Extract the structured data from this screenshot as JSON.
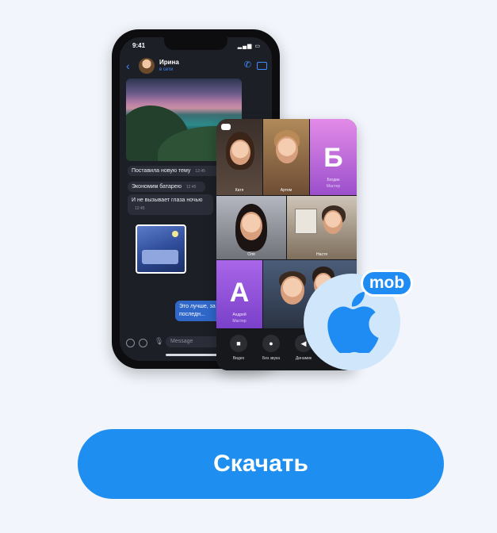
{
  "colors": {
    "background": "#f2f6fc",
    "accent": "#1f8ef1",
    "badge_light": "#cfe6fb"
  },
  "phone": {
    "status_time": "9:41",
    "contact": {
      "name": "Ирина",
      "status": "в сети"
    },
    "messages": [
      {
        "text": "Поставила новую тему",
        "time": "12:45"
      },
      {
        "text": "Экономим батарею",
        "time": "12:45"
      },
      {
        "text": "И не вызывает глаза ночью",
        "time": "12:45"
      }
    ],
    "outgoing_message": "Это лучше, за последн...",
    "composer": {
      "placeholder": "Message"
    },
    "icons": [
      "back-icon",
      "call-icon",
      "video-icon",
      "attach-icon",
      "emoji-icon",
      "mic-icon"
    ]
  },
  "call": {
    "participants": [
      {
        "name": "Катя"
      },
      {
        "name": "Артем"
      },
      {
        "initial": "Б",
        "name": "Богдан",
        "role": "Мастер"
      },
      {
        "name": "Оля"
      },
      {
        "name": "Настя"
      },
      {
        "initial": "А",
        "name": "Андрей",
        "role": "Мастер"
      },
      {
        "name": ""
      }
    ],
    "controls": [
      {
        "label": "Видео",
        "icon": "camera-icon"
      },
      {
        "label": "Без звука",
        "icon": "mute-icon"
      },
      {
        "label": "Динамик",
        "icon": "speaker-icon"
      }
    ]
  },
  "badge": {
    "label": "mob",
    "icon": "apple-icon"
  },
  "download": {
    "label": "Скачать"
  }
}
